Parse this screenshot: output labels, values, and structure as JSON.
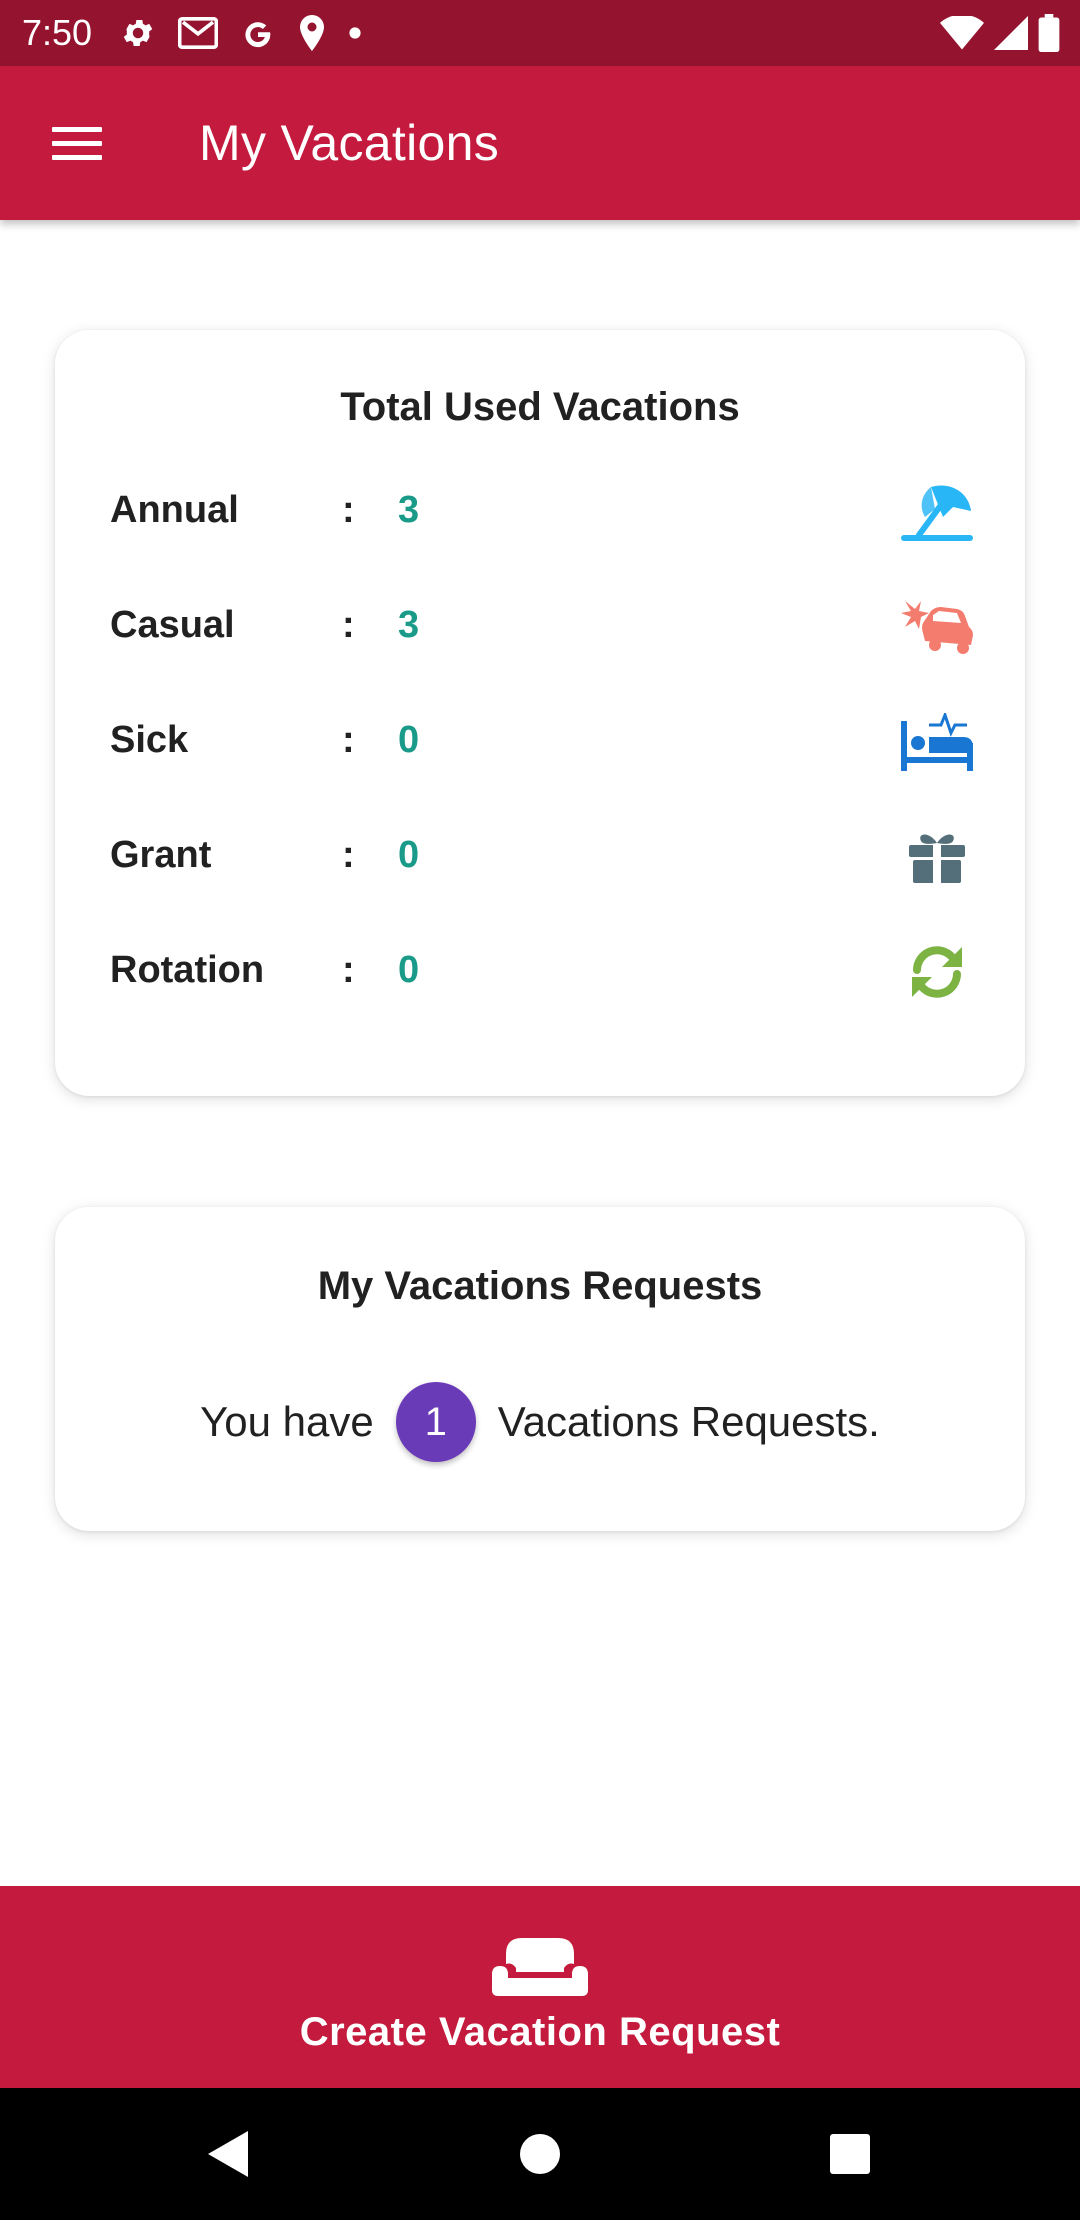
{
  "status_bar": {
    "time": "7:50",
    "left_icons": [
      "gear-icon",
      "gmail-icon",
      "google-icon",
      "location-pin-icon",
      "dot-icon"
    ],
    "right_icons": [
      "wifi-icon",
      "cell-signal-icon",
      "battery-icon"
    ]
  },
  "app_bar": {
    "title": "My Vacations",
    "menu_icon": "hamburger-menu-icon"
  },
  "used_card": {
    "title": "Total Used Vacations",
    "colon": ":",
    "rows": [
      {
        "label": "Annual",
        "value": "3",
        "icon": "beach-umbrella-icon",
        "color": "#29b6f6"
      },
      {
        "label": "Casual",
        "value": "3",
        "icon": "car-crash-icon",
        "color": "#f47c6e"
      },
      {
        "label": "Sick",
        "value": "0",
        "icon": "hospital-bed-icon",
        "color": "#1976d2"
      },
      {
        "label": "Grant",
        "value": "0",
        "icon": "gift-icon",
        "color": "#546e7a"
      },
      {
        "label": "Rotation",
        "value": "0",
        "icon": "sync-icon",
        "color": "#7cb342"
      }
    ]
  },
  "requests_card": {
    "title": "My Vacations Requests",
    "prefix": "You have",
    "count": "1",
    "suffix": "Vacations Requests."
  },
  "create_button": {
    "label": "Create Vacation Request",
    "icon": "couch-icon"
  },
  "nav_bar": {
    "buttons": [
      "back-icon",
      "home-icon",
      "recents-icon"
    ]
  },
  "colors": {
    "primary": "#c41a3d",
    "primary_dark": "#94142f",
    "value_teal": "#1a9a88",
    "badge_purple": "#6a3bb7"
  }
}
